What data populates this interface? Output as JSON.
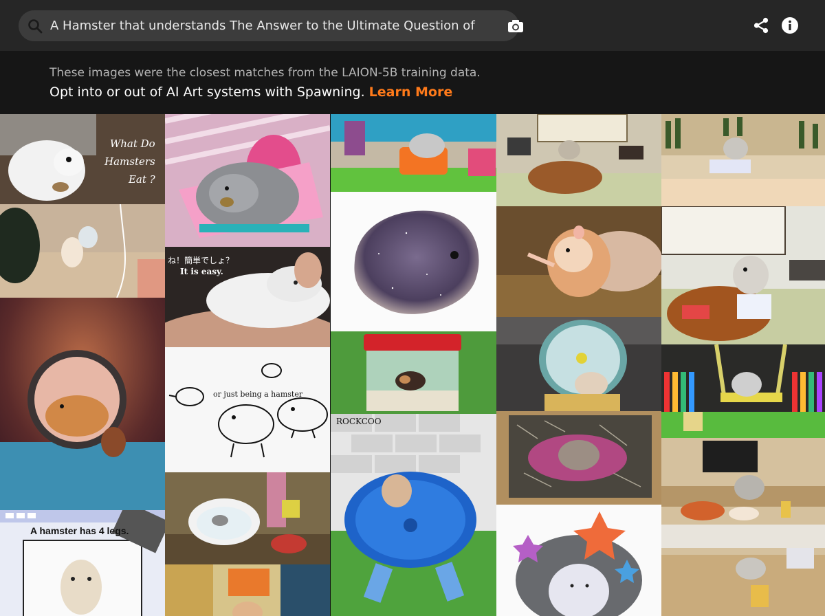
{
  "search": {
    "query": "A Hamster that understands The Answer to the Ultimate Question of Life, th"
  },
  "icons": {
    "search": "search-icon",
    "camera": "camera-icon",
    "share": "share-icon",
    "info": "info-icon"
  },
  "info": {
    "line1": "These images were the closest matches from the LAION-5B training data.",
    "line2": "Opt into or out of AI Art systems with Spawning.",
    "learn_more": "Learn More"
  },
  "colors": {
    "accent": "#ff7a1a",
    "topbar": "#262626",
    "search_bg": "#3c3c3c"
  },
  "captions": {
    "t1_line1": "What Do",
    "t1_line2": "Hamsters",
    "t1_line3": "Eat ?",
    "t8_line1": "ね！簡単でしょ？",
    "t8_line2": "It is easy.",
    "t9": "or just being a hamster",
    "t14": "ROCKCOO",
    "t6": "A hamster has 4 legs."
  }
}
